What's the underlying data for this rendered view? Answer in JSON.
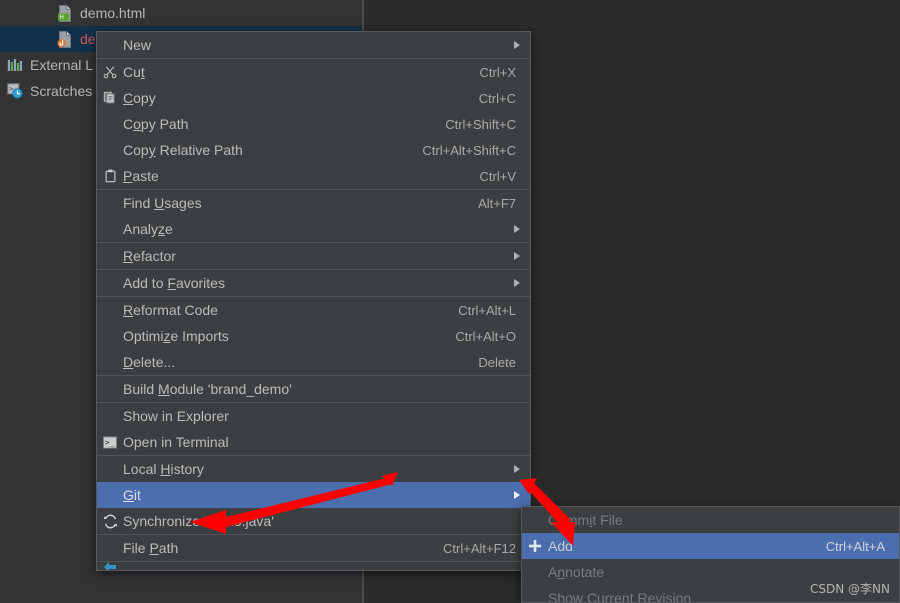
{
  "colors": {
    "menu_bg": "#3c3f41",
    "menu_border": "#565a5c",
    "highlight": "#4b6eaf",
    "panel_bg": "#313335",
    "editor_bg": "#2b2b2b",
    "tree_selected_bg": "#11304a",
    "accent_red": "#ff0000",
    "java_file_text": "#cf5b56",
    "separator": "#515457"
  },
  "project_tree": {
    "items": [
      {
        "label": "demo.html",
        "icon": "html-file-icon",
        "style": "plain",
        "selected": false,
        "indent": "indent-2"
      },
      {
        "label": "demo.java",
        "icon": "java-file-icon",
        "style": "java",
        "selected": true,
        "indent": "indent-2"
      },
      {
        "label": "External L",
        "icon": "external-libraries-icon",
        "style": "plain",
        "selected": false,
        "indent": "indent-0"
      },
      {
        "label": "Scratches",
        "icon": "scratches-icon",
        "style": "plain",
        "selected": false,
        "indent": "indent-0"
      }
    ]
  },
  "context_menu": {
    "items": [
      {
        "type": "item",
        "label": "New",
        "mnemonic": "",
        "accel": "",
        "icon": "",
        "submenu": true,
        "selected": false,
        "disabled": false
      },
      {
        "type": "sep"
      },
      {
        "type": "item",
        "label": "Cut",
        "mnemonic": "t",
        "accel": "Ctrl+X",
        "icon": "scissors-icon",
        "submenu": false,
        "selected": false,
        "disabled": false
      },
      {
        "type": "item",
        "label": "Copy",
        "mnemonic": "C",
        "accel": "Ctrl+C",
        "icon": "copy-icon",
        "submenu": false,
        "selected": false,
        "disabled": false
      },
      {
        "type": "item",
        "label": "Copy Path",
        "mnemonic": "o",
        "accel": "Ctrl+Shift+C",
        "icon": "",
        "submenu": false,
        "selected": false,
        "disabled": false
      },
      {
        "type": "item",
        "label": "Copy Relative Path",
        "mnemonic": "y",
        "accel": "Ctrl+Alt+Shift+C",
        "icon": "",
        "submenu": false,
        "selected": false,
        "disabled": false
      },
      {
        "type": "item",
        "label": "Paste",
        "mnemonic": "P",
        "accel": "Ctrl+V",
        "icon": "clipboard-icon",
        "submenu": false,
        "selected": false,
        "disabled": false
      },
      {
        "type": "sep"
      },
      {
        "type": "item",
        "label": "Find Usages",
        "mnemonic": "U",
        "accel": "Alt+F7",
        "icon": "",
        "submenu": false,
        "selected": false,
        "disabled": false
      },
      {
        "type": "item",
        "label": "Analyze",
        "mnemonic": "z",
        "accel": "",
        "icon": "",
        "submenu": true,
        "selected": false,
        "disabled": false
      },
      {
        "type": "sep"
      },
      {
        "type": "item",
        "label": "Refactor",
        "mnemonic": "R",
        "accel": "",
        "icon": "",
        "submenu": true,
        "selected": false,
        "disabled": false
      },
      {
        "type": "sep"
      },
      {
        "type": "item",
        "label": "Add to Favorites",
        "mnemonic": "F",
        "accel": "",
        "icon": "",
        "submenu": true,
        "selected": false,
        "disabled": false
      },
      {
        "type": "sep"
      },
      {
        "type": "item",
        "label": "Reformat Code",
        "mnemonic": "R",
        "accel": "Ctrl+Alt+L",
        "icon": "",
        "submenu": false,
        "selected": false,
        "disabled": false
      },
      {
        "type": "item",
        "label": "Optimize Imports",
        "mnemonic": "z",
        "accel": "Ctrl+Alt+O",
        "icon": "",
        "submenu": false,
        "selected": false,
        "disabled": false
      },
      {
        "type": "item",
        "label": "Delete...",
        "mnemonic": "D",
        "accel": "Delete",
        "icon": "",
        "submenu": false,
        "selected": false,
        "disabled": false
      },
      {
        "type": "sep"
      },
      {
        "type": "item",
        "label": "Build Module 'brand_demo'",
        "mnemonic": "M",
        "accel": "",
        "icon": "",
        "submenu": false,
        "selected": false,
        "disabled": false
      },
      {
        "type": "sep"
      },
      {
        "type": "item",
        "label": "Show in Explorer",
        "mnemonic": "",
        "accel": "",
        "icon": "",
        "submenu": false,
        "selected": false,
        "disabled": false
      },
      {
        "type": "item",
        "label": "Open in Terminal",
        "mnemonic": "",
        "accel": "",
        "icon": "terminal-icon",
        "submenu": false,
        "selected": false,
        "disabled": false
      },
      {
        "type": "sep"
      },
      {
        "type": "item",
        "label": "Local History",
        "mnemonic": "H",
        "accel": "",
        "icon": "",
        "submenu": true,
        "selected": false,
        "disabled": false
      },
      {
        "type": "item",
        "label": "Git",
        "mnemonic": "G",
        "accel": "",
        "icon": "",
        "submenu": true,
        "selected": true,
        "disabled": false
      },
      {
        "type": "item",
        "label": "Synchronize 'demo.java'",
        "mnemonic": "",
        "accel": "",
        "icon": "sync-icon",
        "submenu": false,
        "selected": false,
        "disabled": false
      },
      {
        "type": "sep"
      },
      {
        "type": "item",
        "label": "File Path",
        "mnemonic": "P",
        "accel": "Ctrl+Alt+F12",
        "icon": "",
        "submenu": false,
        "selected": false,
        "disabled": false
      },
      {
        "type": "sep"
      }
    ]
  },
  "git_submenu": {
    "items": [
      {
        "label": "Commit File",
        "mnemonic": "i",
        "accel": "",
        "icon": "",
        "selected": false,
        "disabled": true
      },
      {
        "label": "Add",
        "mnemonic": "",
        "accel": "Ctrl+Alt+A",
        "icon": "plus-icon",
        "selected": true,
        "disabled": true
      },
      {
        "label": "Annotate",
        "mnemonic": "n",
        "accel": "",
        "icon": "",
        "selected": false,
        "disabled": true
      },
      {
        "label": "Show Current Revision",
        "mnemonic": "",
        "accel": "",
        "icon": "",
        "selected": false,
        "disabled": true
      }
    ]
  },
  "watermark": {
    "text": "CSDN @李NN"
  }
}
